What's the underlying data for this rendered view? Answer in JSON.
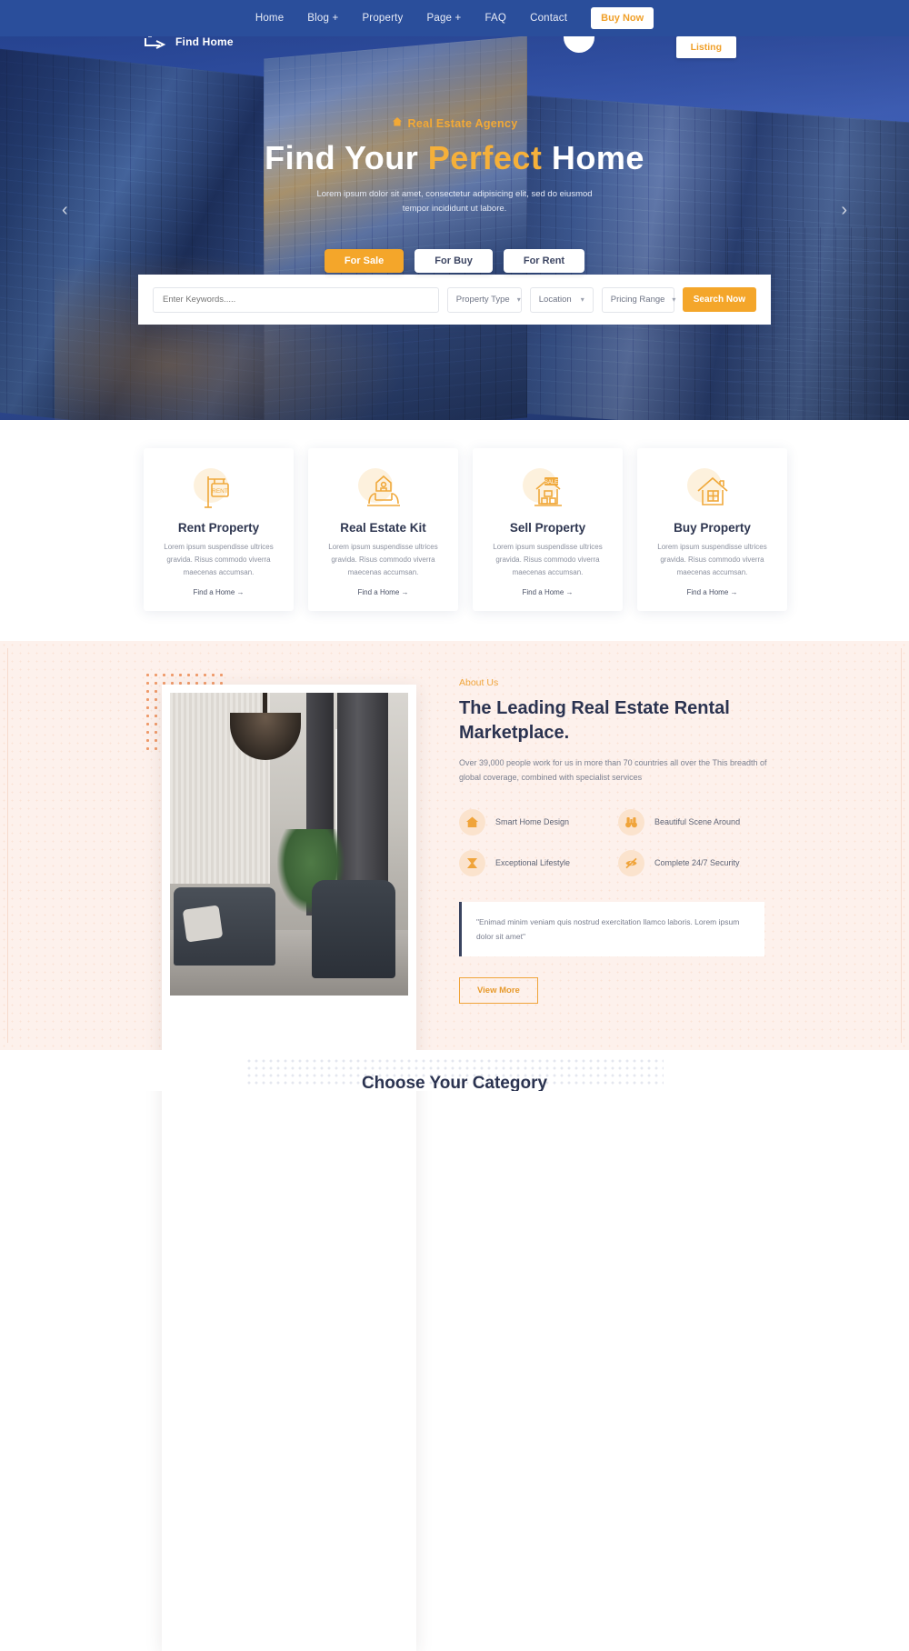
{
  "nav": {
    "items": [
      {
        "label": "Home"
      },
      {
        "label": "Blog +"
      },
      {
        "label": "Property"
      },
      {
        "label": "Page +"
      },
      {
        "label": "FAQ"
      },
      {
        "label": "Contact"
      }
    ],
    "cta_label": "Buy Now",
    "bg_color": "#2a4e9b"
  },
  "brand": {
    "name": "Find Home",
    "icon": "home-arrow-logo"
  },
  "listing_button": {
    "label": "Listing"
  },
  "hero": {
    "eyebrow": "Real Estate Agency",
    "title_part1": "Find Your ",
    "title_highlight": "Perfect",
    "title_part2": " Home",
    "subtitle": "Lorem ipsum dolor sit amet, consectetur adipisicing elit, sed do eiusmod tempor incididunt ut labore.",
    "prev_arrow": "‹",
    "next_arrow": "›",
    "accent_color": "#f5b03a"
  },
  "tabs": [
    {
      "label": "For Sale",
      "active": true
    },
    {
      "label": "For Buy",
      "active": false
    },
    {
      "label": "For Rent",
      "active": false
    }
  ],
  "search": {
    "keyword_placeholder": "Enter Keywords.....",
    "keyword_value": "",
    "property_type": "Property Type",
    "location": "Location",
    "pricing_range": "Pricing Range",
    "button_label": "Search Now"
  },
  "services": {
    "cards": [
      {
        "icon": "rent-sign-icon",
        "title": "Rent Property",
        "text": "Lorem ipsum suspendisse ultrices gravida. Risus commodo viverra maecenas accumsan.",
        "link": "Find a Home →"
      },
      {
        "icon": "house-in-hands-icon",
        "title": "Real Estate Kit",
        "text": "Lorem ipsum suspendisse ultrices gravida. Risus commodo viverra maecenas accumsan.",
        "link": "Find a Home →"
      },
      {
        "icon": "sale-house-icon",
        "title": "Sell Property",
        "text": "Lorem ipsum suspendisse ultrices gravida. Risus commodo viverra maecenas accumsan.",
        "link": "Find a Home →"
      },
      {
        "icon": "house-window-icon",
        "title": "Buy Property",
        "text": "Lorem ipsum suspendisse ultrices gravida. Risus commodo viverra maecenas accumsan.",
        "link": "Find a Home →"
      }
    ]
  },
  "about": {
    "eyebrow": "About Us",
    "title": "The Leading Real Estate Rental Marketplace.",
    "description": "Over 39,000 people work for us in more than 70 countries all over the This breadth of global coverage, combined with specialist services",
    "features": [
      {
        "icon": "home-icon",
        "label": "Smart Home Design"
      },
      {
        "icon": "binoculars-icon",
        "label": "Beautiful Scene Around"
      },
      {
        "icon": "lifestyle-icon",
        "label": "Exceptional Lifestyle"
      },
      {
        "icon": "eye-slash-icon",
        "label": "Complete 24/7 Security"
      }
    ],
    "quote": "\"Enimad minim veniam quis nostrud exercitation llamco laboris. Lorem ipsum dolor sit amet\"",
    "button_label": "View More",
    "photo_alt": "living-room-interior"
  },
  "category": {
    "title": "Choose Your Category"
  }
}
